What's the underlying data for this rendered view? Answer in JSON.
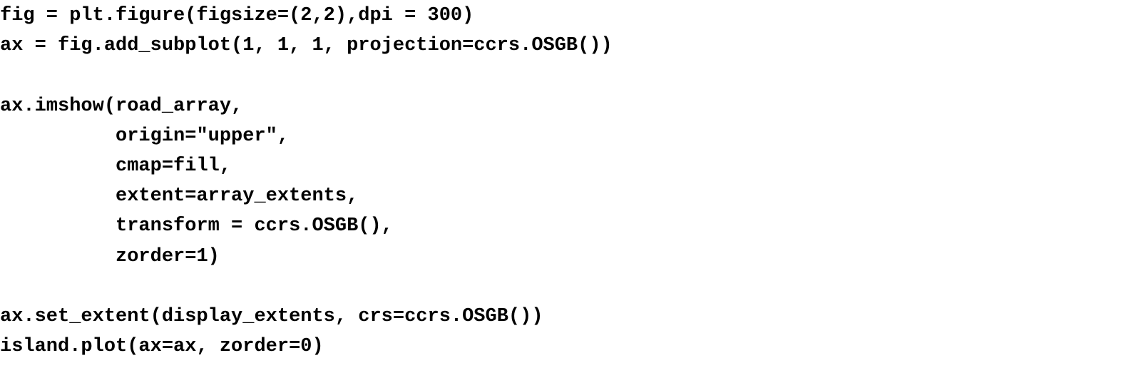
{
  "code": {
    "lines": [
      "fig = plt.figure(figsize=(2,2),dpi = 300)",
      "ax = fig.add_subplot(1, 1, 1, projection=ccrs.OSGB())",
      "",
      "ax.imshow(road_array,",
      "          origin=\"upper\",",
      "          cmap=fill,",
      "          extent=array_extents,",
      "          transform = ccrs.OSGB(),",
      "          zorder=1)",
      "",
      "ax.set_extent(display_extents, crs=ccrs.OSGB())",
      "island.plot(ax=ax, zorder=0)"
    ]
  },
  "colors": {
    "text": "#000000",
    "background": "#ffffff"
  }
}
